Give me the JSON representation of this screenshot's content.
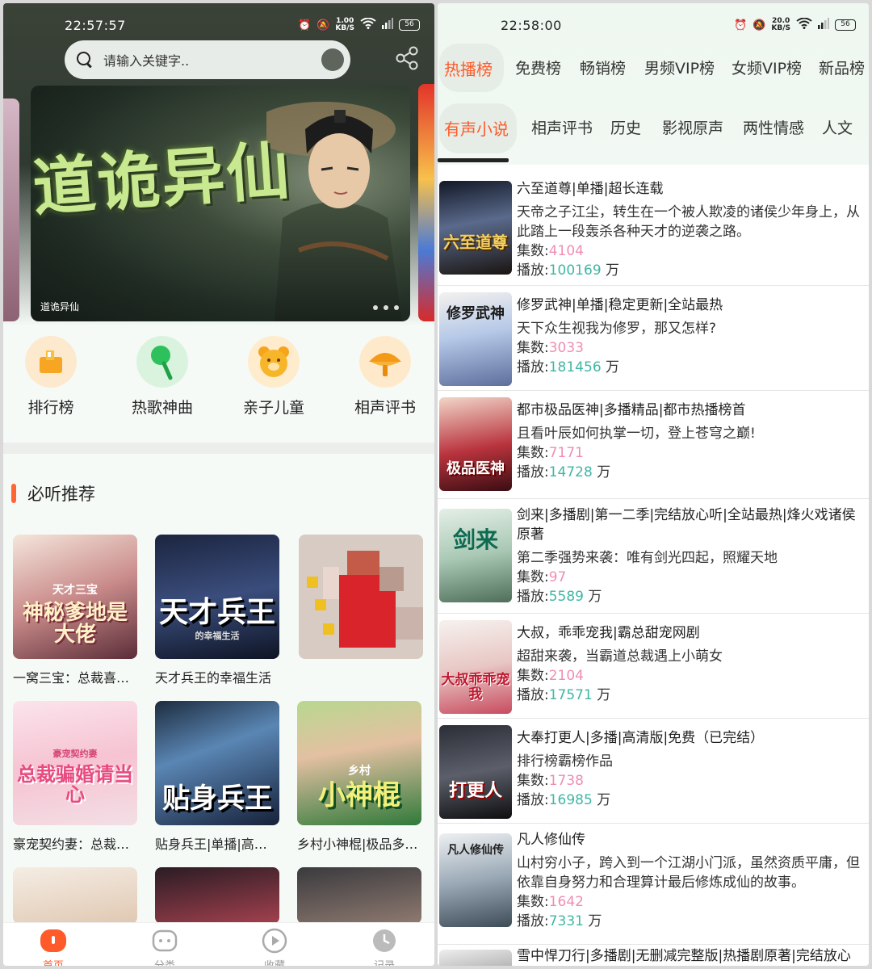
{
  "left": {
    "status": {
      "time": "22:57:57",
      "speed_top": "1.00",
      "speed_bottom": "KB/S",
      "battery": "56"
    },
    "search": {
      "placeholder": "请输入关键字.."
    },
    "banner": {
      "title": "道诡异仙",
      "caption": "道诡异仙",
      "dot_count": 3
    },
    "quick_links": [
      {
        "label": "排行榜",
        "icon": "trophy-icon"
      },
      {
        "label": "热歌神曲",
        "icon": "music-note-icon"
      },
      {
        "label": "亲子儿童",
        "icon": "bear-icon"
      },
      {
        "label": "相声评书",
        "icon": "fan-icon"
      }
    ],
    "section": {
      "title": "必听推荐"
    },
    "books": [
      {
        "title": "一窝三宝：总裁喜…",
        "cover_text": "神秘爹地是大佬",
        "cover_sub": "天才三宝"
      },
      {
        "title": "天才兵王的幸福生活",
        "cover_text": "天才兵王",
        "cover_sub": "的幸福生活"
      },
      {
        "title": "",
        "cover_text": ""
      },
      {
        "title": "豪宠契约妻：总裁…",
        "cover_text": "总裁骗婚请当心",
        "cover_sub": "豪宠契约妻"
      },
      {
        "title": "贴身兵王|单播|高…",
        "cover_text": "贴身兵王"
      },
      {
        "title": "乡村小神棍|极品多…",
        "cover_text": "小神棍",
        "cover_sub": "乡村"
      }
    ],
    "tabbar": [
      {
        "label": "首页",
        "icon": "home-icon",
        "active": true
      },
      {
        "label": "分类",
        "icon": "category-icon"
      },
      {
        "label": "收藏",
        "icon": "play-circle-icon"
      },
      {
        "label": "记录",
        "icon": "clock-icon"
      }
    ]
  },
  "right": {
    "status": {
      "time": "22:58:00",
      "speed_top": "20.0",
      "speed_bottom": "KB/S",
      "battery": "56"
    },
    "rank_tabs": [
      "热播榜",
      "免费榜",
      "畅销榜",
      "男频VIP榜",
      "女频VIP榜",
      "新品榜"
    ],
    "cat_tabs": [
      "有声小说",
      "相声评书",
      "历史",
      "影视原声",
      "两性情感",
      "人文"
    ],
    "labels": {
      "episodes": "集数:",
      "plays": "播放:",
      "wan": "万"
    },
    "items": [
      {
        "title": "六至道尊|单播|超长连载",
        "desc": "天帝之子江尘，转生在一个被人欺凌的诸侯少年身上，从此踏上一段轰杀各种天才的逆袭之路。",
        "episodes": "4104",
        "plays": "100169",
        "cover_text": "六至道尊"
      },
      {
        "title": "修罗武神|单播|稳定更新|全站最热",
        "desc": "天下众生视我为修罗，那又怎样?",
        "episodes": "3033",
        "plays": "181456",
        "cover_text": "修罗武神"
      },
      {
        "title": "都市极品医神|多播精品|都市热播榜首",
        "desc": "且看叶辰如何执掌一切，登上苍穹之巅!",
        "episodes": "7171",
        "plays": "14728",
        "cover_text": "极品医神"
      },
      {
        "title": "剑来|多播剧|第一二季|完结放心听|全站最热|烽火戏诸侯原著",
        "desc": "第二季强势来袭：唯有剑光四起，照耀天地",
        "episodes": "97",
        "plays": "5589",
        "cover_text": "剑来"
      },
      {
        "title": "大叔，乖乖宠我|霸总甜宠网剧",
        "desc": "超甜来袭，当霸道总裁遇上小萌女",
        "episodes": "2104",
        "plays": "17571",
        "cover_text": "大叔乖乖宠我"
      },
      {
        "title": "大奉打更人|多播|高清版|免费（已完结）",
        "desc": "排行榜霸榜作品",
        "episodes": "1738",
        "plays": "16985",
        "cover_text": "打更人"
      },
      {
        "title": "凡人修仙传",
        "desc": "山村穷小子，跨入到一个江湖小门派，虽然资质平庸，但依靠自身努力和合理算计最后修炼成仙的故事。",
        "episodes": "1642",
        "plays": "7331",
        "cover_text": "凡人修仙传"
      },
      {
        "title": "雪中悍刀行|多播剧|无删减完整版|热播剧原著|完结放心",
        "desc": "",
        "episodes": "",
        "plays": "",
        "cover_text": ""
      }
    ]
  }
}
